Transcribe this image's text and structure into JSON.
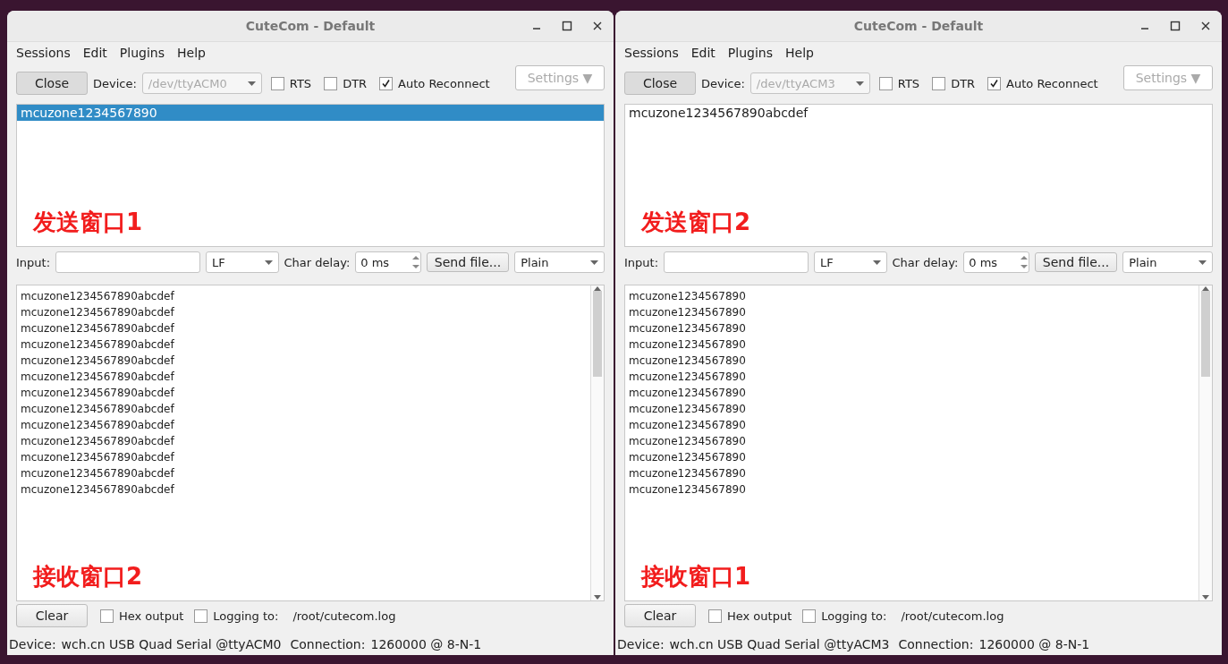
{
  "windows": [
    {
      "title": "CuteCom - Default",
      "menu": [
        "Sessions",
        "Edit",
        "Plugins",
        "Help"
      ],
      "close_button": "Close",
      "device_label": "Device:",
      "device": "/dev/ttyACM0",
      "options": [
        {
          "label": "RTS",
          "checked": false
        },
        {
          "label": "DTR",
          "checked": false
        },
        {
          "label": "Auto Reconnect",
          "checked": true
        }
      ],
      "settings_button": "Settings ▼",
      "history": [
        {
          "text": "mcuzone1234567890",
          "selected": true
        }
      ],
      "send_note": "发送窗口1",
      "input_label": "Input:",
      "line_ending": "LF",
      "char_delay_label": "Char delay:",
      "char_delay": "0 ms",
      "send_file_button": "Send file...",
      "format": "Plain",
      "output_lines": [
        "mcuzone1234567890abcdef",
        "mcuzone1234567890abcdef",
        "mcuzone1234567890abcdef",
        "mcuzone1234567890abcdef",
        "mcuzone1234567890abcdef",
        "mcuzone1234567890abcdef",
        "mcuzone1234567890abcdef",
        "mcuzone1234567890abcdef",
        "mcuzone1234567890abcdef",
        "mcuzone1234567890abcdef",
        "mcuzone1234567890abcdef",
        "mcuzone1234567890abcdef",
        "mcuzone1234567890abcdef"
      ],
      "receive_note": "接收窗口2",
      "clear_button": "Clear",
      "bottom_options": [
        {
          "label": "Hex output",
          "checked": false
        },
        {
          "label": "Logging to:",
          "checked": false
        }
      ],
      "log_path": "/root/cutecom.log",
      "status": {
        "device_label": "Device:",
        "device": "wch.cn USB Quad Serial @ttyACM0",
        "connection_label": "Connection:",
        "connection": "1260000 @ 8-N-1"
      }
    },
    {
      "title": "CuteCom - Default",
      "menu": [
        "Sessions",
        "Edit",
        "Plugins",
        "Help"
      ],
      "close_button": "Close",
      "device_label": "Device:",
      "device": "/dev/ttyACM3",
      "options": [
        {
          "label": "RTS",
          "checked": false
        },
        {
          "label": "DTR",
          "checked": false
        },
        {
          "label": "Auto Reconnect",
          "checked": true
        }
      ],
      "settings_button": "Settings ▼",
      "history": [
        {
          "text": "mcuzone1234567890abcdef",
          "selected": false
        }
      ],
      "send_note": "发送窗口2",
      "input_label": "Input:",
      "line_ending": "LF",
      "char_delay_label": "Char delay:",
      "char_delay": "0 ms",
      "send_file_button": "Send file...",
      "format": "Plain",
      "output_lines": [
        "mcuzone1234567890",
        "mcuzone1234567890",
        "mcuzone1234567890",
        "mcuzone1234567890",
        "mcuzone1234567890",
        "mcuzone1234567890",
        "mcuzone1234567890",
        "mcuzone1234567890",
        "mcuzone1234567890",
        "mcuzone1234567890",
        "mcuzone1234567890",
        "mcuzone1234567890",
        "mcuzone1234567890"
      ],
      "receive_note": "接收窗口1",
      "clear_button": "Clear",
      "bottom_options": [
        {
          "label": "Hex output",
          "checked": false
        },
        {
          "label": "Logging to:",
          "checked": false
        }
      ],
      "log_path": "/root/cutecom.log",
      "status": {
        "device_label": "Device:",
        "device": "wch.cn USB Quad Serial @ttyACM3",
        "connection_label": "Connection:",
        "connection": "1260000 @ 8-N-1"
      }
    }
  ]
}
